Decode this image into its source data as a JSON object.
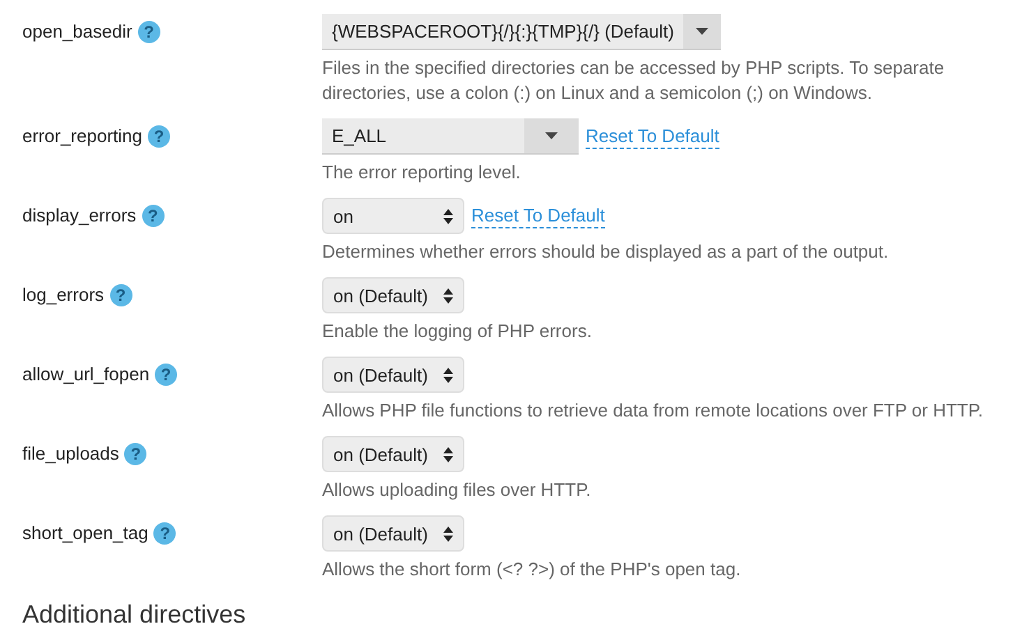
{
  "directives": [
    {
      "name": "open_basedir",
      "help": "?",
      "kind": "combo",
      "value": "{WEBSPACEROOT}{/}{:}{TMP}{/} (Default)",
      "description": "Files in the specified directories can be accessed by PHP scripts. To separate directories, use a colon (:) on Linux and a semicolon (;) on Windows."
    },
    {
      "name": "error_reporting",
      "help": "?",
      "kind": "combo",
      "value": "E_ALL",
      "reset": "Reset To Default",
      "description": "The error reporting level."
    },
    {
      "name": "display_errors",
      "help": "?",
      "kind": "select",
      "value": "on",
      "reset": "Reset To Default",
      "description": "Determines whether errors should be displayed as a part of the output."
    },
    {
      "name": "log_errors",
      "help": "?",
      "kind": "select",
      "value": "on (Default)",
      "description": "Enable the logging of PHP errors."
    },
    {
      "name": "allow_url_fopen",
      "help": "?",
      "kind": "select",
      "value": "on (Default)",
      "description": "Allows PHP file functions to retrieve data from remote locations over FTP or HTTP."
    },
    {
      "name": "file_uploads",
      "help": "?",
      "kind": "select",
      "value": "on (Default)",
      "description": "Allows uploading files over HTTP."
    },
    {
      "name": "short_open_tag",
      "help": "?",
      "kind": "select",
      "value": "on (Default)",
      "description": "Allows the short form (<? ?>) of the PHP's open tag."
    }
  ],
  "section_heading": "Additional directives"
}
